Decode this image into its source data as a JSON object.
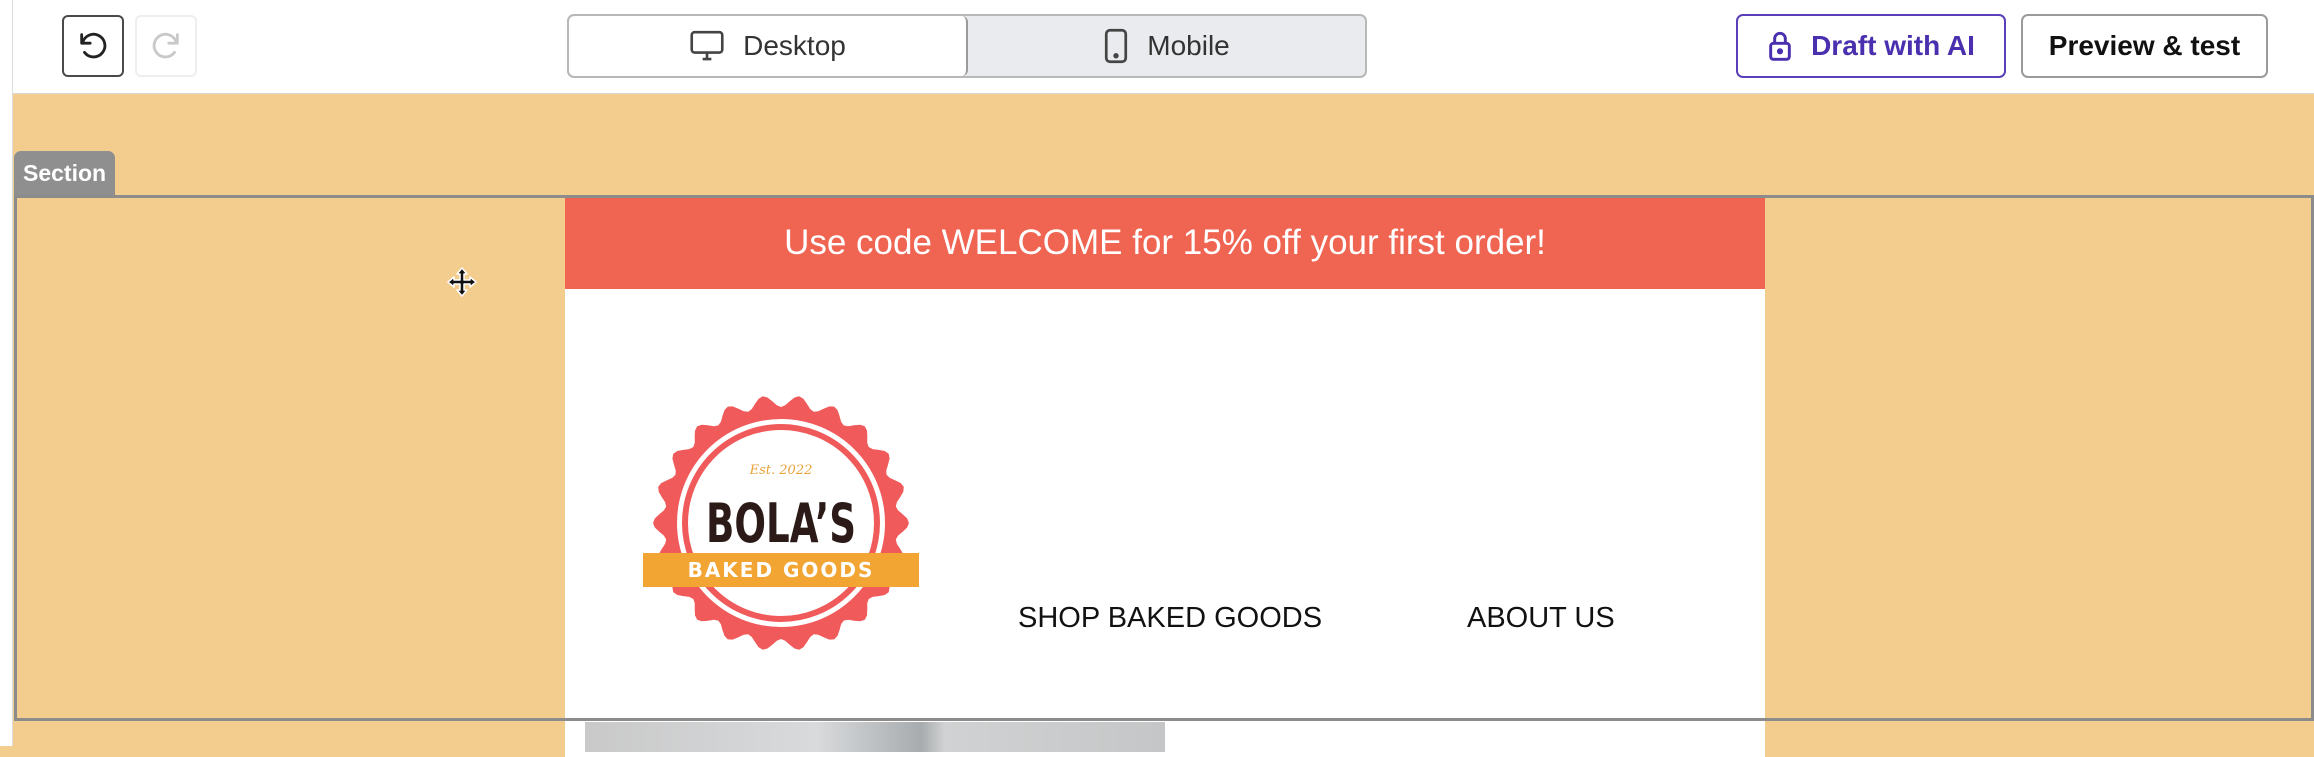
{
  "toolbar": {
    "undo_icon": "undo-icon",
    "redo_icon": "redo-icon",
    "view_toggle": {
      "desktop_label": "Desktop",
      "mobile_label": "Mobile",
      "selected": "Desktop"
    },
    "draft_ai_label": "Draft with AI",
    "preview_label": "Preview & test"
  },
  "canvas": {
    "section_tag": "Section",
    "promo_text": "Use code WELCOME for 15% off your first order!",
    "logo": {
      "est_text": "Est. 2022",
      "name_text": "BOLA’S",
      "ribbon_text": "BAKED GOODS"
    },
    "nav": {
      "shop": "SHOP BAKED GOODS",
      "about": "ABOUT US"
    }
  },
  "colors": {
    "canvas_bg": "#f3cd8d",
    "promo_bg": "#f06452",
    "brand_purple": "#4a2fae",
    "logo_red": "#f05a5a",
    "logo_ribbon": "#f3a533"
  }
}
